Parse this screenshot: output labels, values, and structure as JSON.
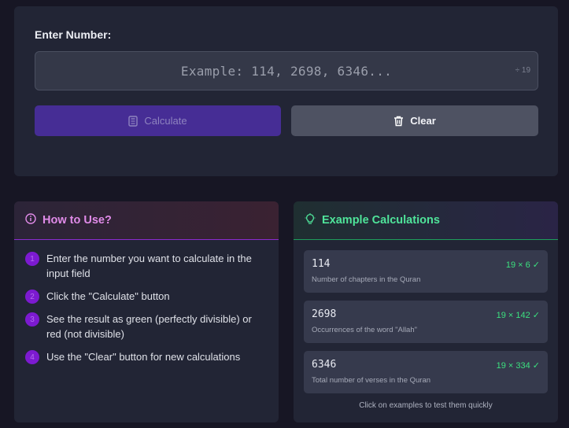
{
  "input_section": {
    "label": "Enter Number:",
    "placeholder": "Example: 114, 2698, 6346...",
    "value": "",
    "divisor_hint": "÷ 19"
  },
  "buttons": {
    "calculate": {
      "label": "Calculate",
      "icon": "calculator-icon"
    },
    "clear": {
      "label": "Clear",
      "icon": "trash-icon"
    }
  },
  "how_to_use": {
    "title": "How to Use?",
    "icon": "info-icon",
    "steps": [
      {
        "num": "1",
        "text": "Enter the number you want to calculate in the input field"
      },
      {
        "num": "2",
        "text": "Click the \"Calculate\" button"
      },
      {
        "num": "3",
        "text": "See the result as green (perfectly divisible) or red (not divisible)"
      },
      {
        "num": "4",
        "text": "Use the \"Clear\" button for new calculations"
      }
    ]
  },
  "examples": {
    "title": "Example Calculations",
    "icon": "lightbulb-icon",
    "items": [
      {
        "number": "114",
        "description": "Number of chapters in the Quran",
        "result": "19 × 6 ✓"
      },
      {
        "number": "2698",
        "description": "Occurrences of the word \"Allah\"",
        "result": "19 × 142 ✓"
      },
      {
        "number": "6346",
        "description": "Total number of verses in the Quran",
        "result": "19 × 334 ✓"
      }
    ],
    "footer": "Click on examples to test them quickly"
  },
  "colors": {
    "background": "#171624",
    "panel": "#222535",
    "calculate_button": "#462d95",
    "clear_button": "#4e5262",
    "how_to_accent": "#e08be8",
    "examples_accent": "#4fe49a",
    "success": "#3ce07f"
  }
}
